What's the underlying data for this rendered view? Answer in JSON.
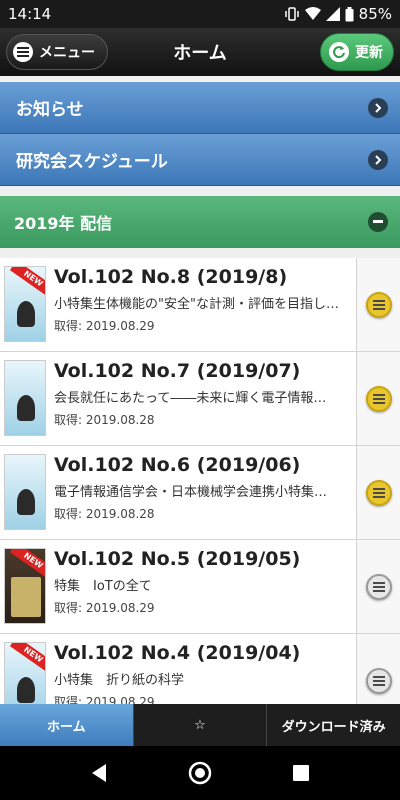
{
  "status": {
    "time": "14:14",
    "battery": "85%"
  },
  "appbar": {
    "menu_label": "メニュー",
    "title": "ホーム",
    "refresh_label": "更新"
  },
  "sections": {
    "news": "お知らせ",
    "schedule": "研究会スケジュール",
    "year": "2019年 配信"
  },
  "items": [
    {
      "title": "Vol.102 No.8 (2019/8)",
      "subtitle": "小特集生体機能の\"安全\"な計測・評価を目指し…",
      "date": "取得: 2019.08.29",
      "new": true,
      "badge": "yellow"
    },
    {
      "title": "Vol.102 No.7 (2019/07)",
      "subtitle": "会長就任にあたって――未来に輝く電子情報…",
      "date": "取得: 2019.08.28",
      "new": false,
      "badge": "yellow"
    },
    {
      "title": "Vol.102 No.6 (2019/06)",
      "subtitle": "電子情報通信学会・日本機械学会連携小特集…",
      "date": "取得: 2019.08.28",
      "new": false,
      "badge": "yellow"
    },
    {
      "title": "Vol.102 No.5 (2019/05)",
      "subtitle": "特集　IoTの全て",
      "date": "取得: 2019.08.29",
      "new": true,
      "badge": "grey"
    },
    {
      "title": "Vol.102 No.4 (2019/04)",
      "subtitle": "小特集　折り紙の科学",
      "date": "取得: 2019.08.29",
      "new": true,
      "badge": "grey"
    }
  ],
  "ribbon_label": "NEW",
  "tabs": {
    "home": "ホーム",
    "favorites": "☆",
    "downloaded": "ダウンロード済み"
  },
  "colors": {
    "accent_blue": "#3d77b8",
    "accent_green": "#3a9a5e",
    "badge_yellow": "#e8c62c"
  }
}
